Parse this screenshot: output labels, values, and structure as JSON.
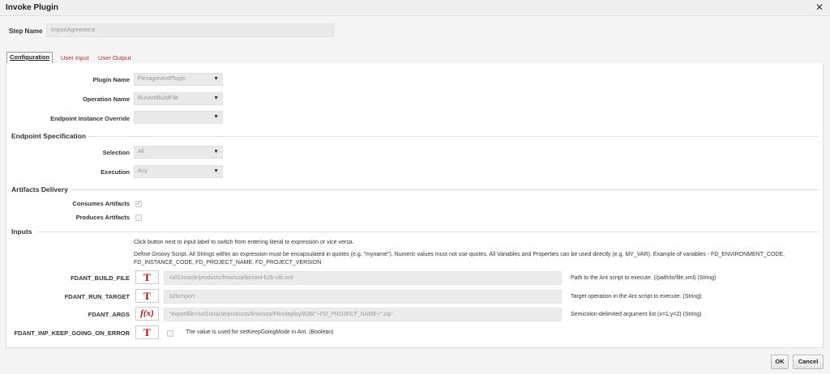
{
  "dialog": {
    "title": "Invoke Plugin",
    "close_icon": "close-icon"
  },
  "step": {
    "label": "Step Name",
    "value": "ImportAgreement"
  },
  "tabs": [
    {
      "label": "Configuration",
      "active": true
    },
    {
      "label": "User Input",
      "active": false
    },
    {
      "label": "User Output",
      "active": false
    }
  ],
  "config": {
    "plugin_name": {
      "label": "Plugin Name",
      "value": "FlexagonAntPlugin"
    },
    "operation_name": {
      "label": "Operation Name",
      "value": "RunAntBuildFile"
    },
    "endpoint_override": {
      "label": "Endpoint Instance Override",
      "value": ""
    }
  },
  "endpoint_spec": {
    "title": "Endpoint Specification",
    "selection": {
      "label": "Selection",
      "value": "All"
    },
    "execution": {
      "label": "Execution",
      "value": "Any"
    }
  },
  "artifacts": {
    "title": "Artifacts Delivery",
    "consumes": {
      "label": "Consumes Artifacts",
      "checked": true
    },
    "produces": {
      "label": "Produces Artifacts",
      "checked": false
    }
  },
  "inputs": {
    "title": "Inputs",
    "hint": "Click button next to input label to switch from entering literal to expression or vice versa.",
    "groovy_line1": "Define Groovy Script. All Strings within an expression must be encapsulated in quotes (e.g. \"myname\"). Numeric values must not use quotes. All Variables and Properties can be used directly (e.g. MY_VAR). Example of variables - FD_ENVIRONMENT_CODE,",
    "groovy_line2": "FD_INSTANCE_CODE, FD_PROJECT_NAME, FD_PROJECT_VERSION",
    "params": [
      {
        "name": "FDANT_BUILD_FILE",
        "mode": "T",
        "value": "/u01/oracle/products/fmw/soa/bin/ant-b2b-util.xml",
        "desc": "Path to the Ant script to execute. (/path/to/file.xml) (String)"
      },
      {
        "name": "FDANT_RUN_TARGET",
        "mode": "T",
        "value": "b2bimport",
        "desc": "Target operation in the Ant script to execute. (String)"
      },
      {
        "name": "FDANT_ARGS",
        "mode": "f(x)",
        "value": "\"exportfile=/u01/oracle/products/fmw/soa/Flexdeploy/B2B/\"+FD_PROJECT_NAME+\".zip\"",
        "desc": "Semicolon-delimited argument list (x=1;y=2) (String)"
      },
      {
        "name": "FDANT_INP_KEEP_GOING_ON_ERROR",
        "mode": "T",
        "checkbox_desc": "The value is used for setKeepGoingMode in Ant. (Boolean)"
      }
    ]
  },
  "footer": {
    "ok_label": "OK",
    "cancel_label": "Cancel"
  }
}
